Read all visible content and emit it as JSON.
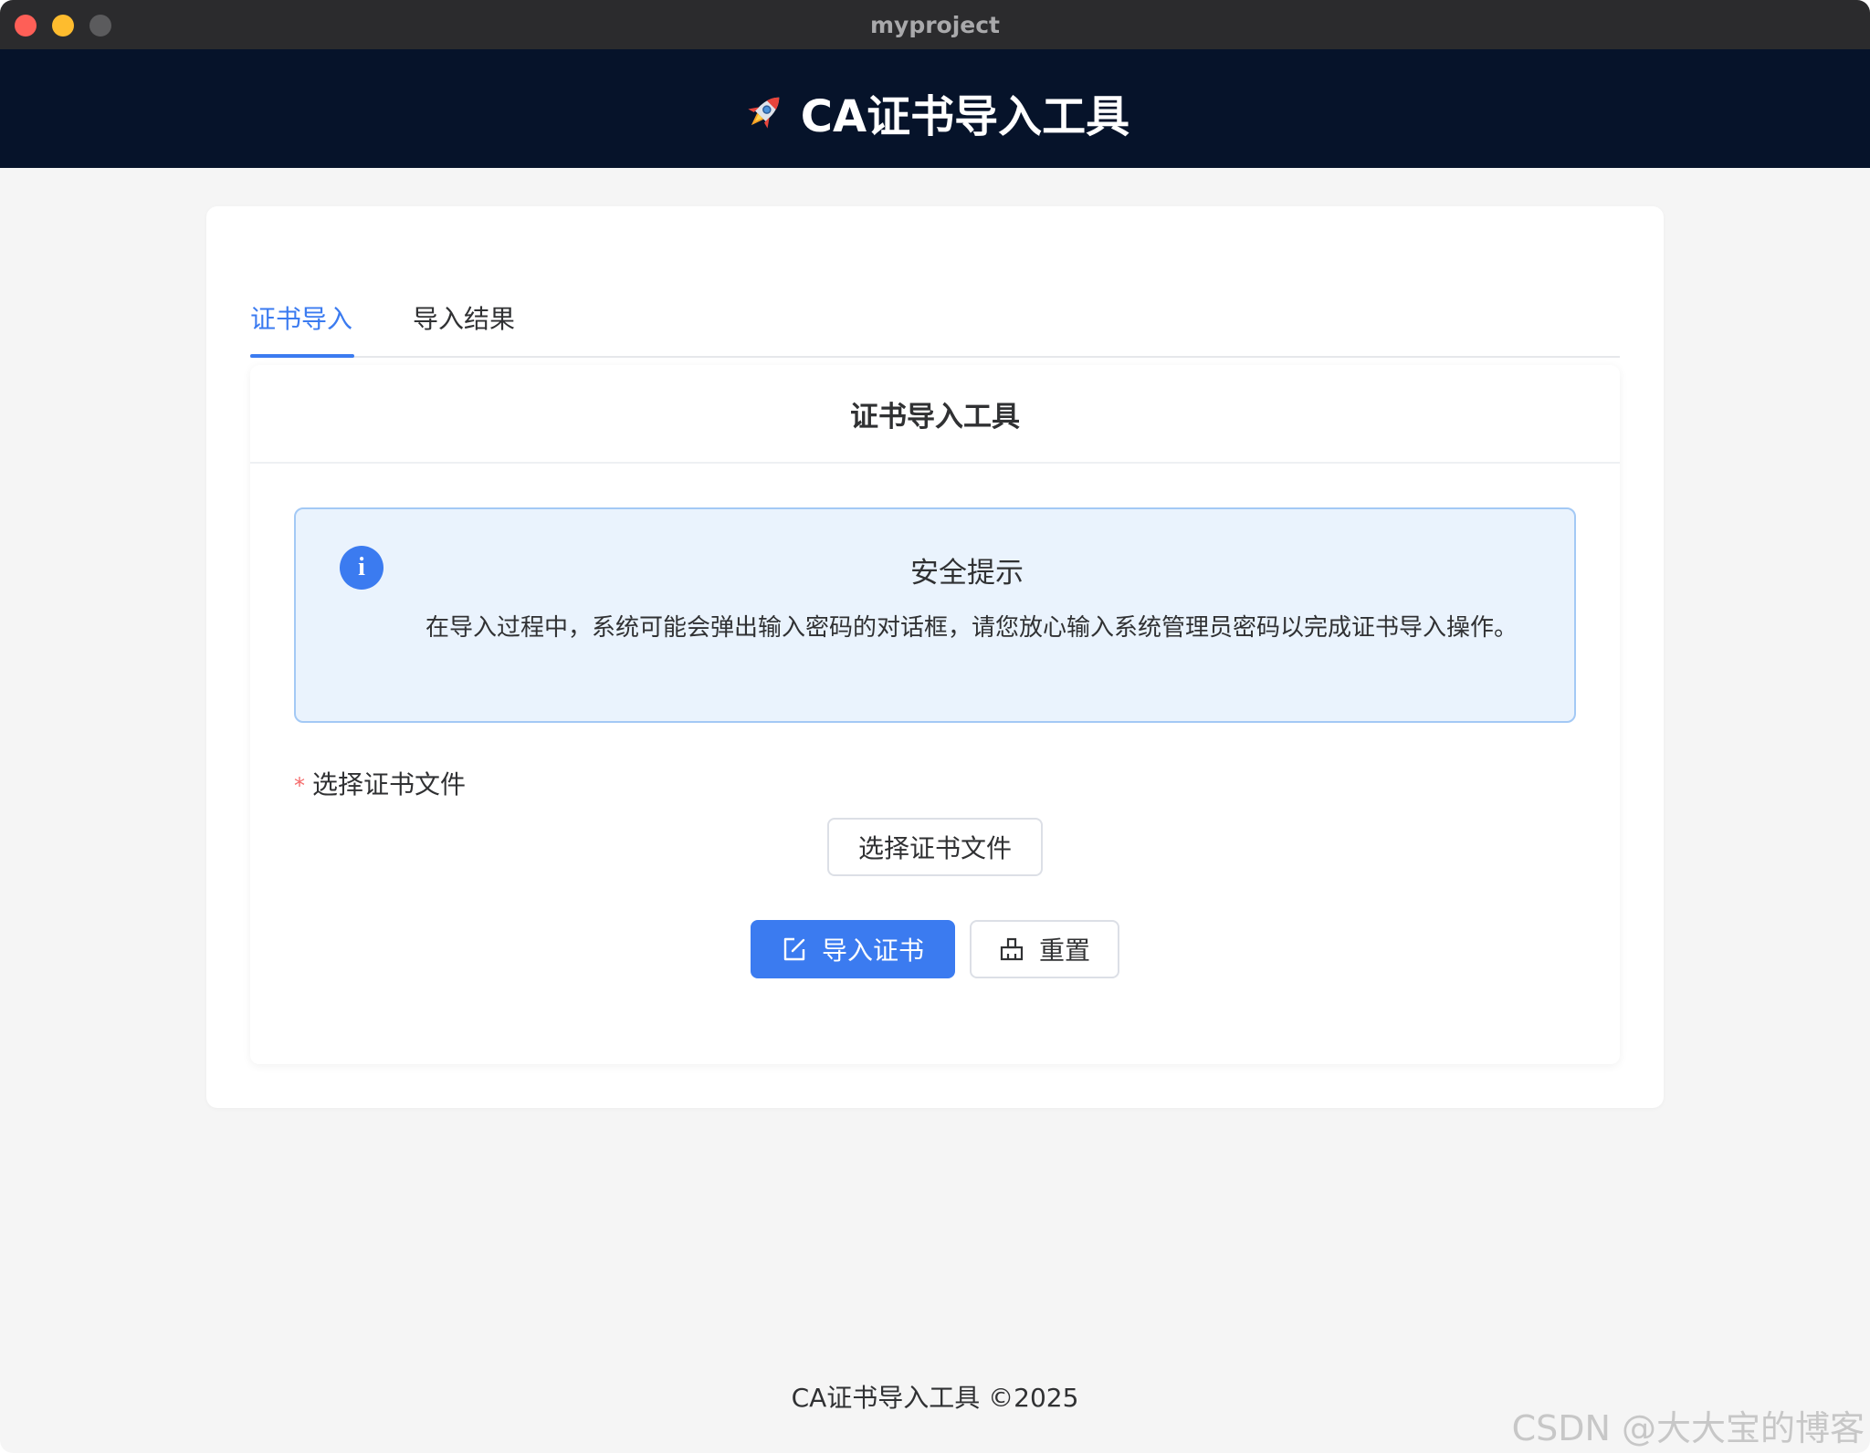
{
  "window": {
    "title": "myproject"
  },
  "header": {
    "title": "CA证书导入工具",
    "icon": "rocket-icon"
  },
  "tabs": [
    {
      "label": "证书导入",
      "active": true
    },
    {
      "label": "导入结果",
      "active": false
    }
  ],
  "panel": {
    "title": "证书导入工具",
    "alert": {
      "icon": "info-icon",
      "title": "安全提示",
      "body": "在导入过程中，系统可能会弹出输入密码的对话框，请您放心输入系统管理员密码以完成证书导入操作。"
    },
    "form": {
      "required_mark": "*",
      "file_label": "选择证书文件",
      "select_button": "选择证书文件",
      "import_button": "导入证书",
      "reset_button": "重置"
    }
  },
  "footer": {
    "text": "CA证书导入工具 ©2025"
  },
  "watermark": "CSDN @大大宝的博客",
  "colors": {
    "primary": "#3b7bf0",
    "header_bg": "#06132a",
    "alert_bg": "#eaf3fd",
    "alert_border": "#a3c9f5",
    "required": "#f56c6c"
  }
}
